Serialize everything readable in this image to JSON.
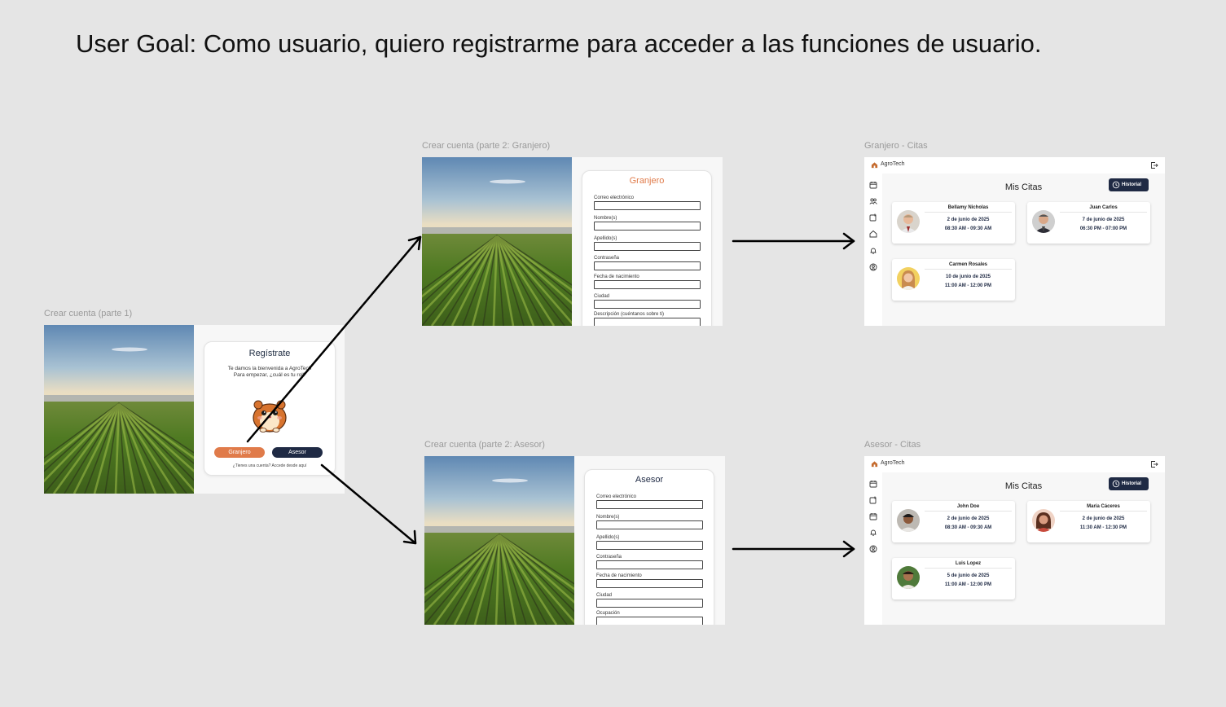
{
  "goal": "User Goal: Como usuario, quiero registrarme para acceder a las funciones de usuario.",
  "colors": {
    "orange": "#e07b4a",
    "navy": "#1f2a44",
    "background": "#e5e5e5"
  },
  "frames": {
    "part1": {
      "label": "Crear cuenta (parte 1)",
      "title": "Regístrate",
      "subtitle_line1": "Te damos la bienvenida a AgroTech",
      "subtitle_line2": "Para empezar, ¿cuál es tu rol?",
      "btn_granjero": "Granjero",
      "btn_asesor": "Asesor",
      "footer": "¿Tienes una cuenta? Accede desde aquí"
    },
    "part2_granjero": {
      "label": "Crear cuenta (parte 2: Granjero)",
      "title": "Granjero",
      "fields": [
        "Correo electrónico",
        "Nombre(s)",
        "Apellido(s)",
        "Contraseña",
        "Fecha de nacimiento",
        "Ciudad",
        "Descripción (cuéntanos sobre ti)"
      ]
    },
    "part2_asesor": {
      "label": "Crear cuenta (parte 2: Asesor)",
      "title": "Asesor",
      "fields": [
        "Correo electrónico",
        "Nombre(s)",
        "Apellido(s)",
        "Contraseña",
        "Fecha de nacimiento",
        "Ciudad",
        "Ocupación"
      ]
    },
    "granjero_citas": {
      "label": "Granjero - Citas",
      "app_name": "AgroTech",
      "heading": "Mis Citas",
      "history": "Historial",
      "citas": [
        {
          "name": "Bellamy Nicholas",
          "date": "2 de junio de 2025",
          "time": "08:30 AM - 09:30 AM"
        },
        {
          "name": "Juan Carlos",
          "date": "7 de junio de 2025",
          "time": "06:30 PM - 07:00 PM"
        },
        {
          "name": "Carmen Rosales",
          "date": "10 de junio de 2025",
          "time": "11:00 AM - 12:00 PM"
        }
      ]
    },
    "asesor_citas": {
      "label": "Asesor - Citas",
      "app_name": "AgroTech",
      "heading": "Mis Citas",
      "history": "Historial",
      "citas": [
        {
          "name": "John Doe",
          "date": "2 de junio de 2025",
          "time": "08:30 AM - 09:30 AM"
        },
        {
          "name": "María Cáceres",
          "date": "2 de junio de 2025",
          "time": "11:30 AM - 12:30 PM"
        },
        {
          "name": "Luis Lopez",
          "date": "5 de junio de 2025",
          "time": "11:00 AM - 12:00 PM"
        }
      ]
    }
  }
}
